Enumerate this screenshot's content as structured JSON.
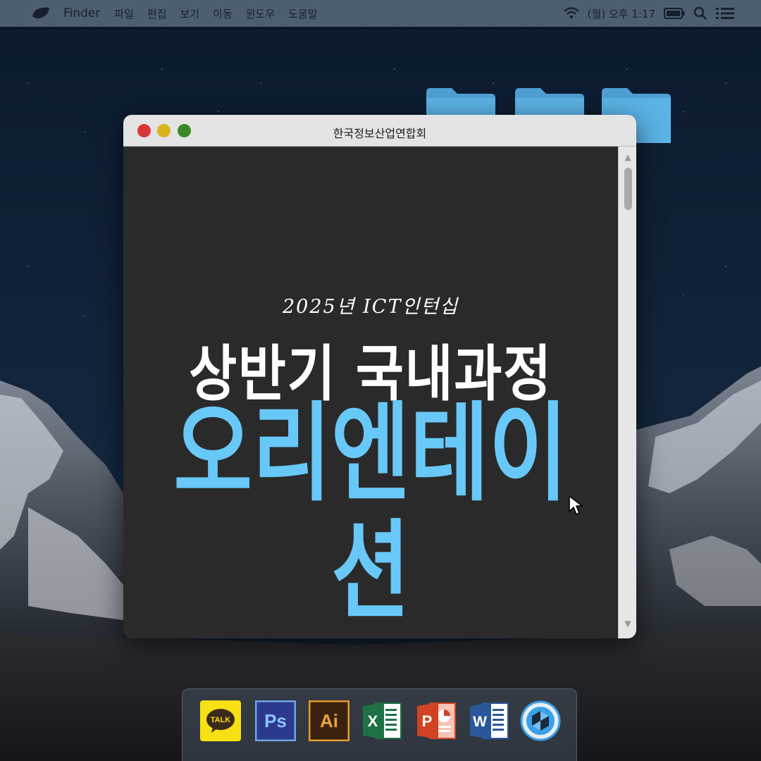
{
  "menubar": {
    "app_name": "Finder",
    "menus": [
      "파일",
      "편집",
      "보기",
      "이동",
      "윈도우",
      "도움말"
    ],
    "clock": "(월) 오후 1:17",
    "icons": [
      "apple-icon",
      "wifi-icon",
      "battery-icon",
      "search-icon",
      "list-icon"
    ]
  },
  "desktop": {
    "folders": [
      "folder-icon",
      "folder-icon",
      "folder-icon"
    ]
  },
  "window": {
    "title": "한국정보산업연합회",
    "subtitle": "2025년 ICT인턴십",
    "headline": "상반기 국내과정",
    "big_title": "오리엔테이션",
    "scroll_up": "▲",
    "scroll_down": "▼",
    "colors": {
      "content_bg": "#2a2a2a",
      "accent": "#68c8f8",
      "close": "#d8373a",
      "minimize": "#d9b51c",
      "zoom": "#3b8a2a"
    }
  },
  "dock": {
    "apps": [
      {
        "name": "KakaoTalk",
        "label": "TALK",
        "icon": "kakaotalk-icon",
        "color": "#f7e014"
      },
      {
        "name": "Photoshop",
        "label": "Ps",
        "icon": "photoshop-icon",
        "color": "#2b3a8c"
      },
      {
        "name": "Illustrator",
        "label": "Ai",
        "icon": "illustrator-icon",
        "color": "#3a2210"
      },
      {
        "name": "Excel",
        "label": "X",
        "icon": "excel-icon",
        "color": "#1e7145"
      },
      {
        "name": "PowerPoint",
        "label": "P",
        "icon": "powerpoint-icon",
        "color": "#d04423"
      },
      {
        "name": "Word",
        "label": "W",
        "icon": "word-icon",
        "color": "#2b579a"
      },
      {
        "name": "Keynote",
        "label": "",
        "icon": "keynote-icon",
        "color": "#3aa0e8"
      }
    ]
  }
}
